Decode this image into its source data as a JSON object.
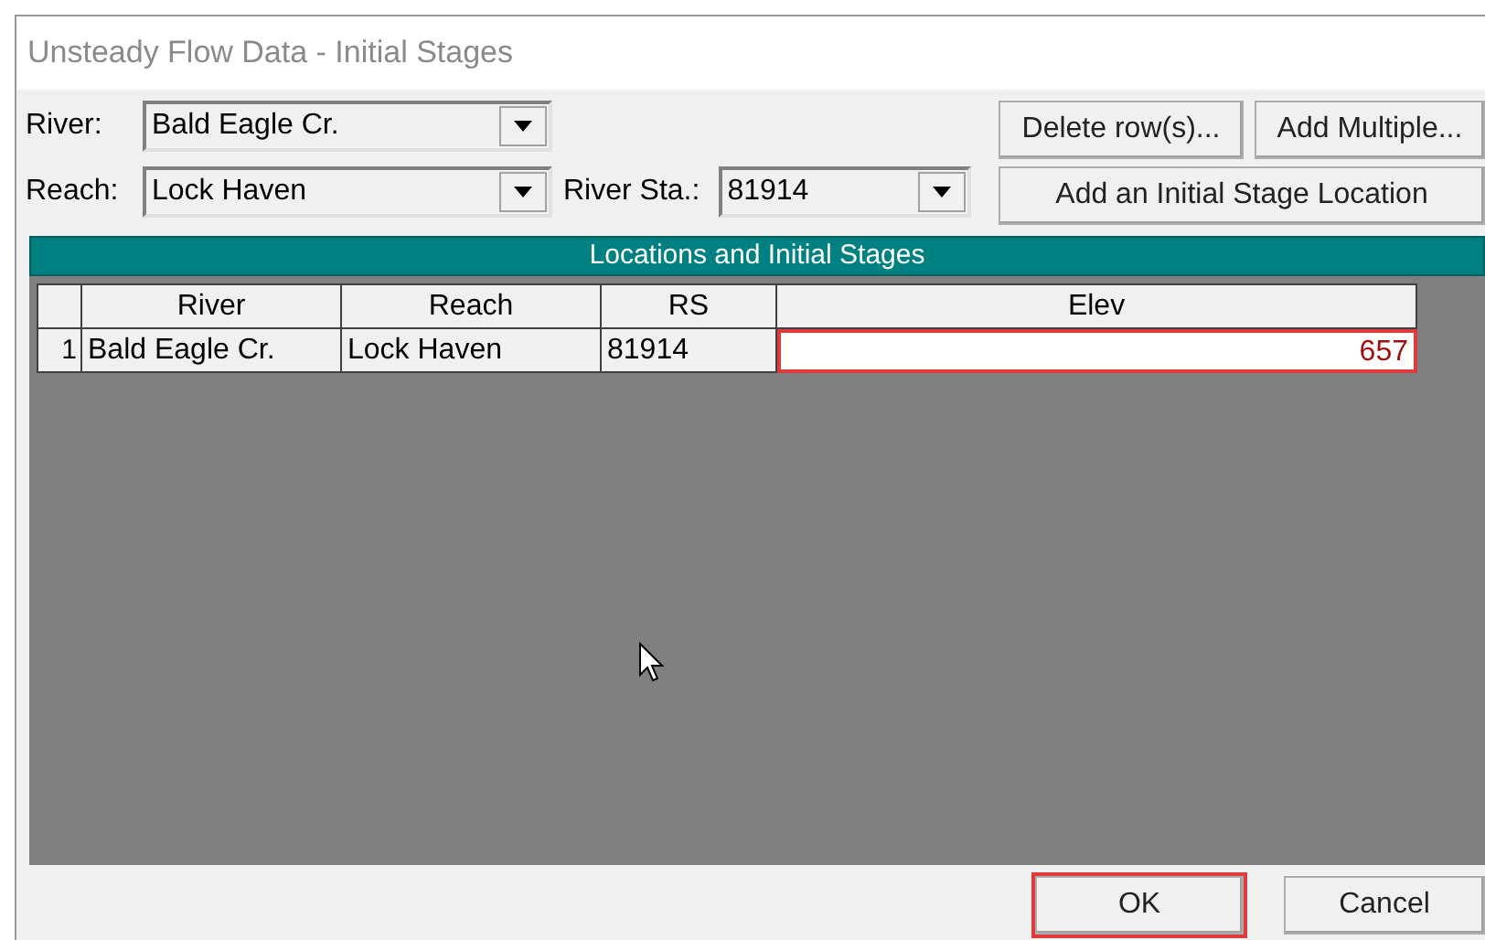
{
  "window": {
    "title": "Unsteady Flow Data - Initial Stages"
  },
  "river": {
    "label": "River:",
    "value": "Bald Eagle Cr."
  },
  "reach": {
    "label": "Reach:",
    "value": "Lock Haven"
  },
  "river_station": {
    "label": "River Sta.:",
    "value": "81914"
  },
  "buttons": {
    "delete": "Delete row(s)...",
    "add_multiple": "Add Multiple...",
    "add_location": "Add an Initial Stage Location"
  },
  "table": {
    "title": "Locations and Initial Stages",
    "columns": [
      "River",
      "Reach",
      "RS",
      "Elev"
    ],
    "rows": [
      {
        "number": "1",
        "cells": [
          "Bald Eagle Cr.",
          "Lock Haven",
          "81914",
          "657"
        ],
        "highlighted": true
      }
    ]
  },
  "footer": [
    {
      "label": "OK",
      "highlighted": true
    },
    {
      "label": "Cancel",
      "highlighted": false
    }
  ]
}
